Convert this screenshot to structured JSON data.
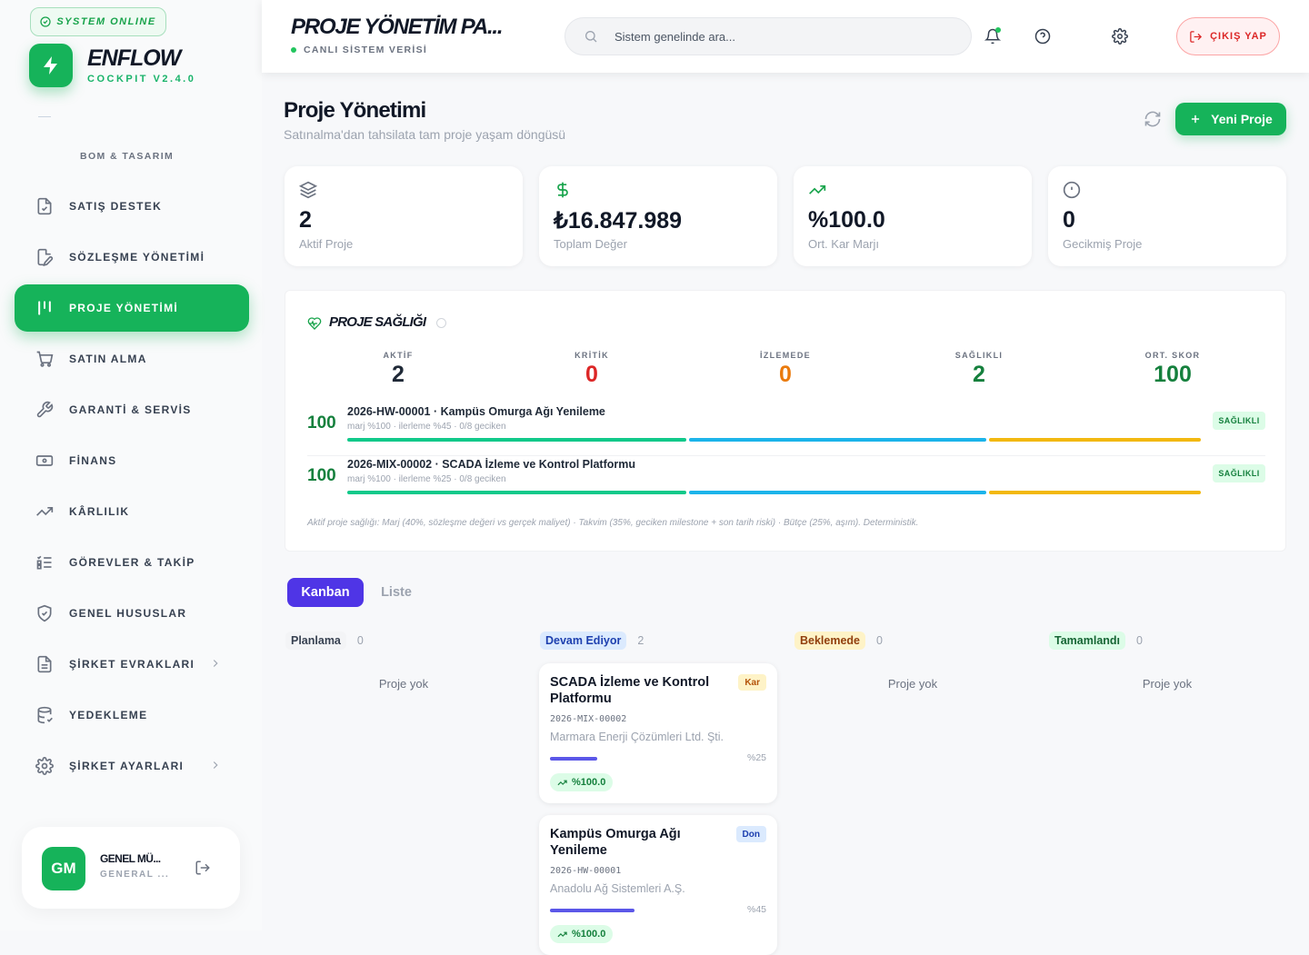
{
  "sidebar": {
    "status": "SYSTEM ONLINE",
    "brand": "ENFLOW",
    "brand_sub": "COCKPIT V2.4.0",
    "section_label": "BOM & TASARIM",
    "items": [
      {
        "label": "SATIŞ DESTEK",
        "icon": "file-check-icon"
      },
      {
        "label": "SÖZLEŞME YÖNETİMİ",
        "icon": "file-edit-icon"
      },
      {
        "label": "PROJE YÖNETİMİ",
        "icon": "kanban-icon"
      },
      {
        "label": "SATIN ALMA",
        "icon": "cart-icon"
      },
      {
        "label": "GARANTİ & SERVİS",
        "icon": "wrench-icon"
      },
      {
        "label": "FİNANS",
        "icon": "banknote-icon"
      },
      {
        "label": "KÂRLILIK",
        "icon": "trending-up-icon"
      },
      {
        "label": "GÖREVLER & TAKİP",
        "icon": "list-check-icon"
      },
      {
        "label": "GENEL HUSUSLAR",
        "icon": "shield-icon"
      },
      {
        "label": "ŞİRKET EVRAKLARI",
        "icon": "document-icon"
      },
      {
        "label": "YEDEKLEME",
        "icon": "database-icon"
      },
      {
        "label": "ŞİRKET AYARLARI",
        "icon": "gear-icon"
      }
    ],
    "user": {
      "initials": "GM",
      "name": "GENEL MÜ...",
      "role": "GENERAL ..."
    }
  },
  "topbar": {
    "title": "PROJE YÖNETİM PA...",
    "subtitle": "CANLI SİSTEM VERİSİ",
    "search_placeholder": "Sistem genelinde ara...",
    "logout_label": "ÇIKIŞ YAP"
  },
  "page": {
    "title": "Proje Yönetimi",
    "subtitle": "Satınalma'dan tahsilata tam proje yaşam döngüsü",
    "new_button": "Yeni Proje"
  },
  "stats": [
    {
      "value": "2",
      "label": "Aktif Proje",
      "icon": "layers-icon",
      "color": "#6b7280"
    },
    {
      "value": "₺16.847.989",
      "label": "Toplam Değer",
      "icon": "dollar-icon",
      "color": "#16a34a"
    },
    {
      "value": "%100.0",
      "label": "Ort. Kar Marjı",
      "icon": "trending-up-icon",
      "color": "#16a34a"
    },
    {
      "value": "0",
      "label": "Gecikmiş Proje",
      "icon": "alert-circle-icon",
      "color": "#6b7280"
    }
  ],
  "health": {
    "title": "PROJE SAĞLIĞI",
    "metrics": [
      {
        "label": "AKTİF",
        "value": "2",
        "color": "#1f2937"
      },
      {
        "label": "KRİTİK",
        "value": "0",
        "color": "#dc2626"
      },
      {
        "label": "İZLEMEDE",
        "value": "0",
        "color": "#ea7a0c"
      },
      {
        "label": "SAĞLIKLI",
        "value": "2",
        "color": "#15803d"
      },
      {
        "label": "ORT. SKOR",
        "value": "100",
        "color": "#15803d"
      }
    ],
    "projects": [
      {
        "score": "100",
        "name": "2026-HW-00001 · Kampüs Omurga Ağı Yenileme",
        "meta": "marj %100 · ilerleme %45 · 0/8 geciken",
        "badge": "SAĞLIKLI"
      },
      {
        "score": "100",
        "name": "2026-MIX-00002 · SCADA İzleme ve Kontrol Platformu",
        "meta": "marj %100 · ilerleme %25 · 0/8 geciken",
        "badge": "SAĞLIKLI"
      }
    ],
    "footnote": "Aktif proje sağlığı: Marj (40%, sözleşme değeri vs gerçek maliyet) · Takvim (35%, geciken milestone + son tarih riski) · Bütçe (25%, aşım). Deterministik."
  },
  "tabs": [
    "Kanban",
    "Liste"
  ],
  "kanban": {
    "columns": [
      {
        "name": "Planlama",
        "count": "0",
        "empty": "Proje yok",
        "bg": "#f3f4f6",
        "fg": "#374151"
      },
      {
        "name": "Devam Ediyor",
        "count": "2",
        "empty": "",
        "bg": "#dbeafe",
        "fg": "#1e40af"
      },
      {
        "name": "Beklemede",
        "count": "0",
        "empty": "Proje yok",
        "bg": "#fef3c7",
        "fg": "#92400e"
      },
      {
        "name": "Tamamlandı",
        "count": "0",
        "empty": "Proje yok",
        "bg": "#dcfce7",
        "fg": "#166534"
      }
    ],
    "cards": [
      {
        "title": "SCADA İzleme ve Kontrol Platformu",
        "tag": "Kar",
        "code": "2026-MIX-00002",
        "customer": "Marmara Enerji Çözümleri Ltd. Şti.",
        "progress": 0.25,
        "progress_label": "%25",
        "margin": "%100.0"
      },
      {
        "title": "Kampüs Omurga Ağı Yenileme",
        "tag": "Don",
        "code": "2026-HW-00001",
        "customer": "Anadolu Ağ Sistemleri A.Ş.",
        "progress": 0.45,
        "progress_label": "%45",
        "margin": "%100.0"
      }
    ]
  }
}
